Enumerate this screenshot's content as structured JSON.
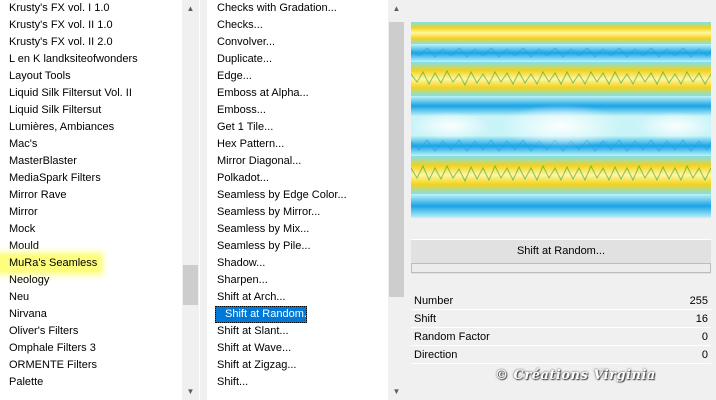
{
  "categories": {
    "items": [
      "Krusty's FX vol. I 1.0",
      "Krusty's FX vol. II 1.0",
      "Krusty's FX vol. II 2.0",
      "L en K landksiteofwonders",
      "Layout Tools",
      "Liquid Silk Filtersut Vol. II",
      "Liquid Silk Filtersut",
      "Lumières, Ambiances",
      "Mac's",
      "MasterBlaster",
      "MediaSpark Filters",
      "Mirror Rave",
      "Mirror",
      "Mock",
      "Mould",
      "MuRa's Seamless",
      "Neology",
      "Neu",
      "Nirvana",
      "Oliver's Filters",
      "Omphale Filters 3",
      "ORMENTE Filters",
      "Palette"
    ],
    "highlighted_index": 15
  },
  "filters": {
    "items": [
      "Checks with Gradation...",
      "Checks...",
      "Convolver...",
      "Duplicate...",
      "Edge...",
      "Emboss at Alpha...",
      "Emboss...",
      "Get 1 Tile...",
      "Hex Pattern...",
      "Mirror Diagonal...",
      "Polkadot...",
      "Seamless by Edge Color...",
      "Seamless by Mirror...",
      "Seamless by Mix...",
      "Seamless by Pile...",
      "Shadow...",
      "Sharpen...",
      "Shift at Arch...",
      "Shift at Random...",
      "Shift at Slant...",
      "Shift at Wave...",
      "Shift at Zigzag...",
      "Shift..."
    ],
    "selected_index": 18
  },
  "preset": {
    "label": "Shift at Random..."
  },
  "params": [
    {
      "name": "Number",
      "value": "255"
    },
    {
      "name": "Shift",
      "value": "16"
    },
    {
      "name": "Random Factor",
      "value": "0"
    },
    {
      "name": "Direction",
      "value": "0"
    }
  ],
  "watermark": "© Créations Virginia",
  "icons": {
    "scroll_up": "triangle-up-icon",
    "scroll_down": "triangle-down-icon"
  },
  "colors": {
    "selection": "#0078d7",
    "highlight": "#fefe7e",
    "preview_yellow": "#f2d21c",
    "preview_cyan": "#7fe0ec",
    "preview_blue": "#1aa3e6",
    "preview_green": "#1f9a4a"
  }
}
